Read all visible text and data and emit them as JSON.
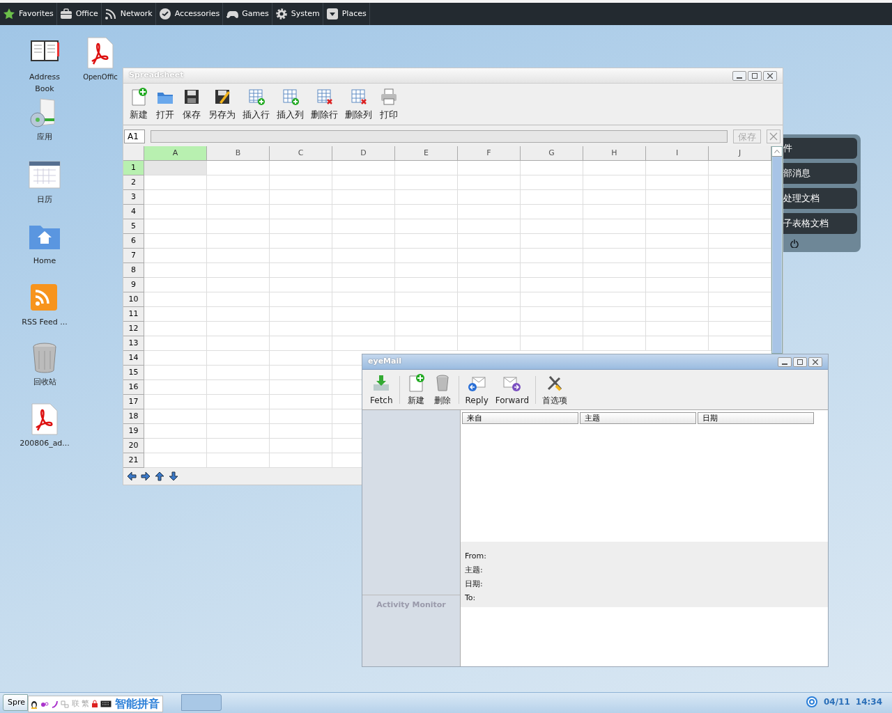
{
  "menu_bar": {
    "items": [
      {
        "label": "Favorites",
        "kind": "star"
      },
      {
        "label": "Office",
        "kind": "briefcase"
      },
      {
        "label": "Network",
        "kind": "signal"
      },
      {
        "label": "Accessories",
        "kind": "check"
      },
      {
        "label": "Games",
        "kind": "gamepad"
      },
      {
        "label": "System",
        "kind": "gear"
      },
      {
        "label": "Places",
        "kind": "dropdown"
      }
    ]
  },
  "desktop_icons": [
    {
      "label": "Address Book",
      "kind": "book"
    },
    {
      "label": "OpenOffic",
      "kind": "pdf"
    },
    {
      "label": "应用",
      "kind": "software"
    },
    {
      "label": "日历",
      "kind": "calendar"
    },
    {
      "label": "Home",
      "kind": "home"
    },
    {
      "label": "RSS Feed ...",
      "kind": "rss"
    },
    {
      "label": "回收站",
      "kind": "trash"
    },
    {
      "label": "200806_ad...",
      "kind": "pdf"
    }
  ],
  "side_panel": {
    "items": [
      "件",
      "部消息",
      "处理文档",
      "子表格文档"
    ]
  },
  "spreadsheet": {
    "title": "Spreadsheet",
    "toolbar": [
      {
        "label": "新建",
        "kind": "new"
      },
      {
        "label": "打开",
        "kind": "open"
      },
      {
        "label": "保存",
        "kind": "save"
      },
      {
        "label": "另存为",
        "kind": "saveas"
      },
      {
        "label": "插入行",
        "kind": "addrow"
      },
      {
        "label": "插入列",
        "kind": "addcol"
      },
      {
        "label": "删除行",
        "kind": "delrow"
      },
      {
        "label": "删除列",
        "kind": "delcol"
      },
      {
        "label": "打印",
        "kind": "print"
      }
    ],
    "cell_ref": "A1",
    "save_button": {
      "label": "保存",
      "disabled": true
    },
    "columns": [
      {
        "label": "A",
        "selected": true
      },
      {
        "label": "B",
        "selected": false
      },
      {
        "label": "C",
        "selected": false
      },
      {
        "label": "D",
        "selected": false
      },
      {
        "label": "E",
        "selected": false
      },
      {
        "label": "F",
        "selected": false
      },
      {
        "label": "G",
        "selected": false
      },
      {
        "label": "H",
        "selected": false
      },
      {
        "label": "I",
        "selected": false
      },
      {
        "label": "J",
        "selected": false
      }
    ],
    "rows": [
      {
        "label": "1",
        "selected": true
      },
      {
        "label": "2",
        "selected": false
      },
      {
        "label": "3",
        "selected": false
      },
      {
        "label": "4",
        "selected": false
      },
      {
        "label": "5",
        "selected": false
      },
      {
        "label": "6",
        "selected": false
      },
      {
        "label": "7",
        "selected": false
      },
      {
        "label": "8",
        "selected": false
      },
      {
        "label": "9",
        "selected": false
      },
      {
        "label": "10",
        "selected": false
      },
      {
        "label": "11",
        "selected": false
      },
      {
        "label": "12",
        "selected": false
      },
      {
        "label": "13",
        "selected": false
      },
      {
        "label": "14",
        "selected": false
      },
      {
        "label": "15",
        "selected": false
      },
      {
        "label": "16",
        "selected": false
      },
      {
        "label": "17",
        "selected": false
      },
      {
        "label": "18",
        "selected": false
      },
      {
        "label": "19",
        "selected": false
      },
      {
        "label": "20",
        "selected": false
      },
      {
        "label": "21",
        "selected": false
      }
    ]
  },
  "email": {
    "title": "eyeMail",
    "toolbar": [
      {
        "label": "Fetch",
        "kind": "fetch"
      },
      {
        "label": "新建",
        "kind": "new"
      },
      {
        "label": "删除",
        "kind": "delete"
      },
      {
        "label": "Reply",
        "kind": "reply"
      },
      {
        "label": "Forward",
        "kind": "forward"
      },
      {
        "label": "首选项",
        "kind": "tools"
      }
    ],
    "columns": [
      "来自",
      "主题",
      "日期"
    ],
    "sidebar_header": "Activity Monitor",
    "preview_fields": [
      "From:",
      "主题:",
      "日期:",
      "To:"
    ]
  },
  "taskbar": {
    "tasks": [
      {
        "label": "Spre"
      }
    ],
    "ime": {
      "glyphs": [
        "联",
        "繁"
      ],
      "label": "智能拼音"
    },
    "date": "04/11",
    "time": "14:34"
  }
}
